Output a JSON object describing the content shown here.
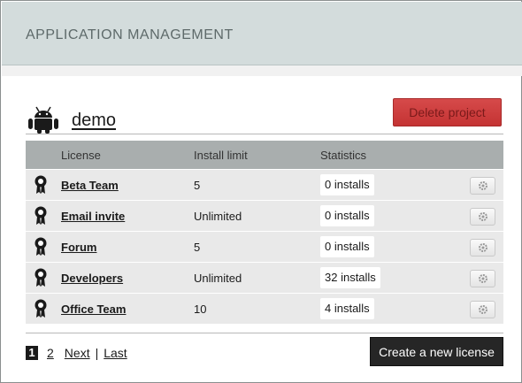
{
  "header": {
    "title": "APPLICATION MANAGEMENT"
  },
  "project": {
    "name": "demo",
    "delete_label": "Delete project",
    "platform_icon": "android-icon"
  },
  "table": {
    "columns": [
      "License",
      "Install limit",
      "Statistics"
    ],
    "rows": [
      {
        "license": "Beta Team",
        "install_limit": "5",
        "statistics": "0 installs"
      },
      {
        "license": "Email invite",
        "install_limit": "Unlimited",
        "statistics": "0 installs"
      },
      {
        "license": "Forum",
        "install_limit": "5",
        "statistics": "0 installs"
      },
      {
        "license": "Developers",
        "install_limit": "Unlimited",
        "statistics": "32 installs"
      },
      {
        "license": "Office Team",
        "install_limit": "10",
        "statistics": "4 installs"
      }
    ],
    "row_icon": "ribbon-award-icon",
    "settings_icon": "gear-icon"
  },
  "pagination": {
    "current": "1",
    "page2": "2",
    "next": "Next",
    "separator": "|",
    "last": "Last"
  },
  "actions": {
    "create_label": "Create a new license"
  },
  "colors": {
    "header_bg": "#d3dcdc",
    "delete_red": "#c43333",
    "table_head": "#a9aeae",
    "row_bg": "#e9e9e9",
    "create_bg": "#262626"
  }
}
